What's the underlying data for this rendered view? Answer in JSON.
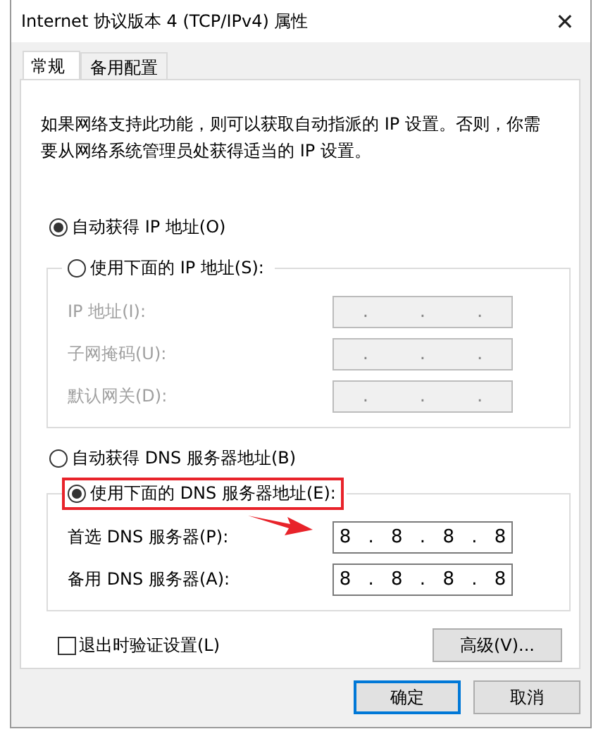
{
  "window": {
    "title": "Internet 协议版本 4 (TCP/IPv4) 属性",
    "close": "✕"
  },
  "tabs": [
    {
      "label": "常规",
      "selected": true
    },
    {
      "label": "备用配置",
      "selected": false
    }
  ],
  "description": "如果网络支持此功能，则可以获取自动指派的 IP 设置。否则，你需要从网络系统管理员处获得适当的 IP 设置。",
  "ip_mode": [
    {
      "label": "自动获得 IP 地址(O)",
      "selected": true,
      "highlighted": false
    },
    {
      "label": "使用下面的 IP 地址(S):",
      "selected": false,
      "highlighted": false
    }
  ],
  "ip_fields": [
    {
      "label": "IP 地址(I):",
      "value": ".   .   .",
      "disabled": true
    },
    {
      "label": "子网掩码(U):",
      "value": ".   .   .",
      "disabled": true
    },
    {
      "label": "默认网关(D):",
      "value": ".   .   .",
      "disabled": true
    }
  ],
  "dns_mode": [
    {
      "label": "自动获得 DNS 服务器地址(B)",
      "selected": false,
      "highlighted": false
    },
    {
      "label": "使用下面的 DNS 服务器地址(E):",
      "selected": true,
      "highlighted": true
    }
  ],
  "dns_fields": [
    {
      "label": "首选 DNS 服务器(P):",
      "value": "8 . 8 . 8 . 8",
      "disabled": false
    },
    {
      "label": "备用 DNS 服务器(A):",
      "value": "8 . 8 . 8 . 8",
      "disabled": false
    }
  ],
  "validate_on_exit": {
    "label": "退出时验证设置(L)",
    "checked": false
  },
  "advanced_button": "高级(V)...",
  "buttons": [
    {
      "label": "确定",
      "default": true
    },
    {
      "label": "取消",
      "default": false
    }
  ]
}
